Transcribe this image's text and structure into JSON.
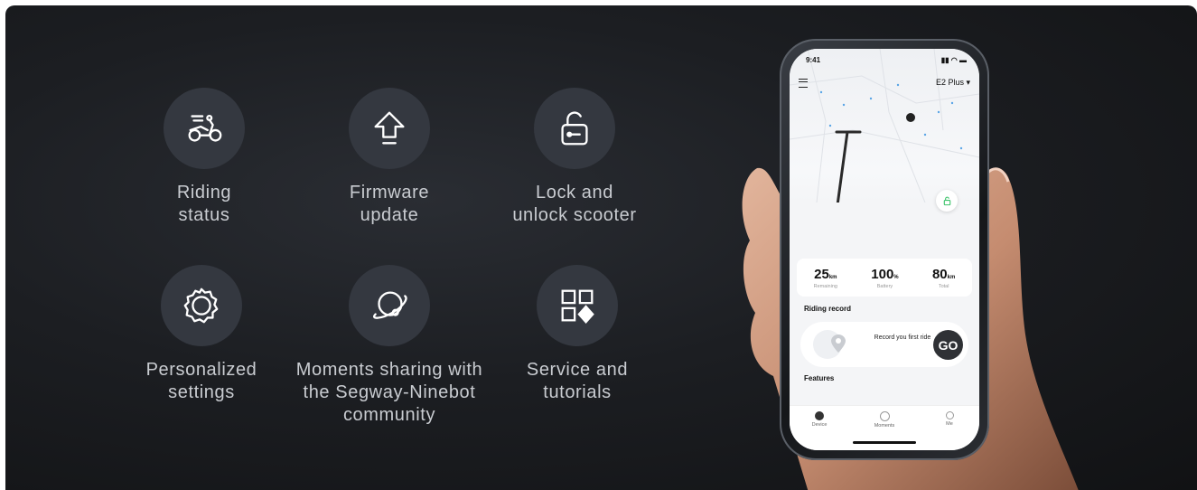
{
  "features": [
    {
      "icon": "scooter-riding-icon",
      "label": "Riding\nstatus"
    },
    {
      "icon": "upload-arrow-icon",
      "label": "Firmware\nupdate"
    },
    {
      "icon": "unlock-icon",
      "label": "Lock and\nunlock scooter"
    },
    {
      "icon": "gear-icon",
      "label": "Personalized\nsettings"
    },
    {
      "icon": "planet-icon",
      "label": "Moments sharing with\nthe Segway-Ninebot\ncommunity"
    },
    {
      "icon": "grid-diamond-icon",
      "label": "Service and\ntutorials"
    }
  ],
  "phone": {
    "status_time": "9:41",
    "device_name": "E2 Plus ▾",
    "stats": [
      {
        "value": "25",
        "unit": "km",
        "label": "Remaining"
      },
      {
        "value": "100",
        "unit": "%",
        "label": "Battery"
      },
      {
        "value": "80",
        "unit": "km",
        "label": "Total"
      }
    ],
    "riding_record_title": "Riding record",
    "record_text": "Record you first ride",
    "go_label": "GO",
    "features_title": "Features",
    "tabs": [
      {
        "label": "Device"
      },
      {
        "label": "Moments"
      },
      {
        "label": "Me"
      }
    ]
  },
  "colors": {
    "background": "#1c1e22",
    "icon_circle": "#343840",
    "label_text": "#c9ccd1",
    "lock_accent": "#3cc36a"
  }
}
